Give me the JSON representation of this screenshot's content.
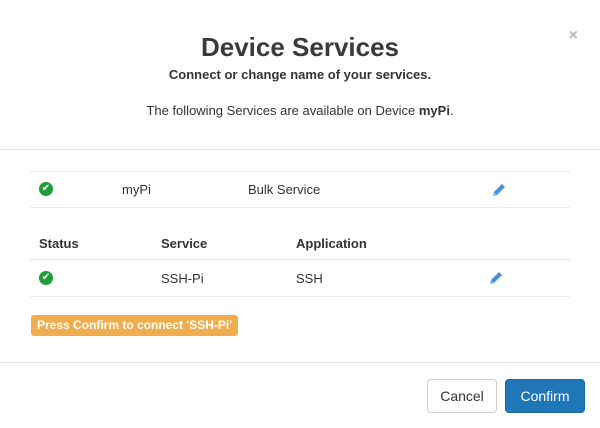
{
  "dialog": {
    "title": "Device Services",
    "subtitle": "Connect or change name of your services.",
    "info_prefix": "The following Services are available on Device ",
    "device_name": "myPi",
    "info_suffix": ".",
    "close_label": "×"
  },
  "bulk_row": {
    "status": "ok",
    "name": "myPi",
    "application": "Bulk Service"
  },
  "table": {
    "headers": [
      "Status",
      "Service",
      "Application"
    ],
    "rows": [
      {
        "status": "ok",
        "service": "SSH-Pi",
        "application": "SSH"
      }
    ]
  },
  "hint": "Press Confirm to connect 'SSH-Pi'",
  "footer": {
    "cancel_label": "Cancel",
    "confirm_label": "Confirm"
  },
  "colors": {
    "status_ok": "#1f9d3a",
    "edit_icon": "#4a90d9",
    "hint_bg": "#f0ad4e",
    "confirm_bg": "#2077b8"
  },
  "icons": {
    "status": "check-circle-icon",
    "edit": "pencil-icon",
    "close": "close-icon"
  }
}
